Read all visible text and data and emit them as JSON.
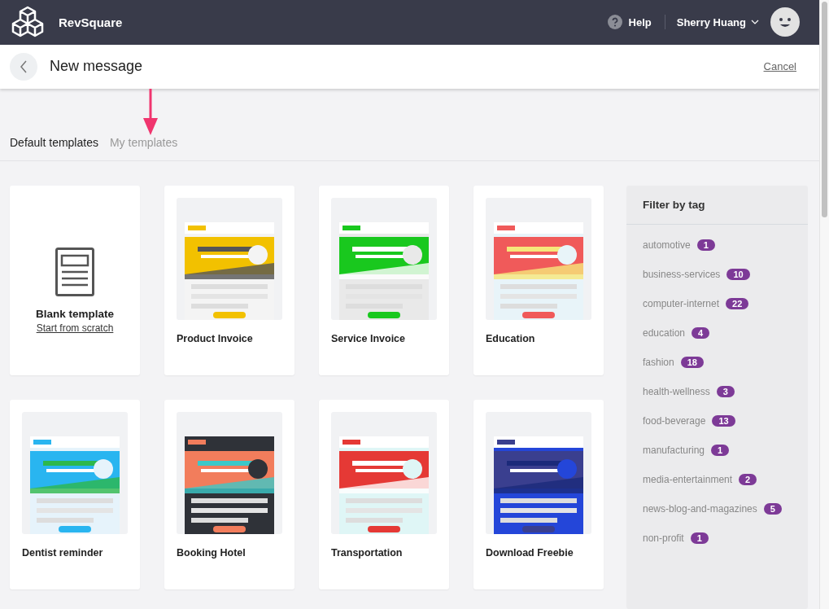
{
  "app": {
    "name": "RevSquare",
    "help": "Help",
    "user": "Sherry Huang"
  },
  "page": {
    "title": "New message",
    "cancel": "Cancel"
  },
  "tabs": [
    {
      "label": "Default templates",
      "selected": true
    },
    {
      "label": "My templates",
      "selected": false
    }
  ],
  "blank_template": {
    "title": "Blank template",
    "link": "Start from scratch"
  },
  "templates": [
    {
      "name": "Product Invoice"
    },
    {
      "name": "Service Invoice"
    },
    {
      "name": "Education"
    },
    {
      "name": "Dentist reminder"
    },
    {
      "name": "Booking Hotel"
    },
    {
      "name": "Transportation"
    },
    {
      "name": "Download Freebie"
    }
  ],
  "filter": {
    "title": "Filter by tag",
    "tags": [
      {
        "label": "automotive",
        "count": "1"
      },
      {
        "label": "business-services",
        "count": "10"
      },
      {
        "label": "computer-internet",
        "count": "22"
      },
      {
        "label": "education",
        "count": "4"
      },
      {
        "label": "fashion",
        "count": "18"
      },
      {
        "label": "health-wellness",
        "count": "3"
      },
      {
        "label": "food-beverage",
        "count": "13"
      },
      {
        "label": "manufacturing",
        "count": "1"
      },
      {
        "label": "media-entertainment",
        "count": "2"
      },
      {
        "label": "news-blog-and-magazines",
        "count": "5"
      },
      {
        "label": "non-profit",
        "count": "1"
      }
    ]
  }
}
